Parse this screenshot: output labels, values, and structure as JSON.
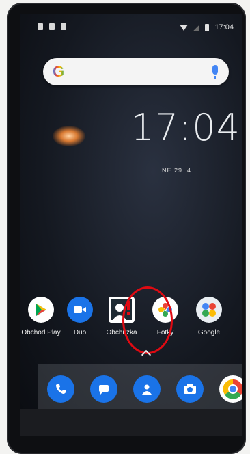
{
  "status_bar": {
    "time": "17:04"
  },
  "search": {
    "logo": "G"
  },
  "home_clock": {
    "time": "17:04",
    "date": "NE 29. 4."
  },
  "apps": [
    {
      "label": "Obchod Play",
      "icon": "play-store-icon",
      "color": "#ffffff"
    },
    {
      "label": "Duo",
      "icon": "duo-icon",
      "color": "#1a73e8"
    },
    {
      "label": "Obchůzka",
      "icon": "obchuzka-icon",
      "color": "#ffffff"
    },
    {
      "label": "Fotky",
      "icon": "photos-icon",
      "color": "#ffffff"
    },
    {
      "label": "Google",
      "icon": "google-folder-icon",
      "color": "#ffffff"
    }
  ],
  "dock": [
    {
      "icon": "phone-icon",
      "color": "#1a73e8"
    },
    {
      "icon": "messages-icon",
      "color": "#1a73e8"
    },
    {
      "icon": "contacts-icon",
      "color": "#1a73e8"
    },
    {
      "icon": "camera-icon",
      "color": "#1a73e8"
    },
    {
      "icon": "chrome-icon",
      "color": "#ffffff"
    }
  ],
  "colors": {
    "highlight": "#e00a12",
    "accent": "#1a73e8"
  }
}
